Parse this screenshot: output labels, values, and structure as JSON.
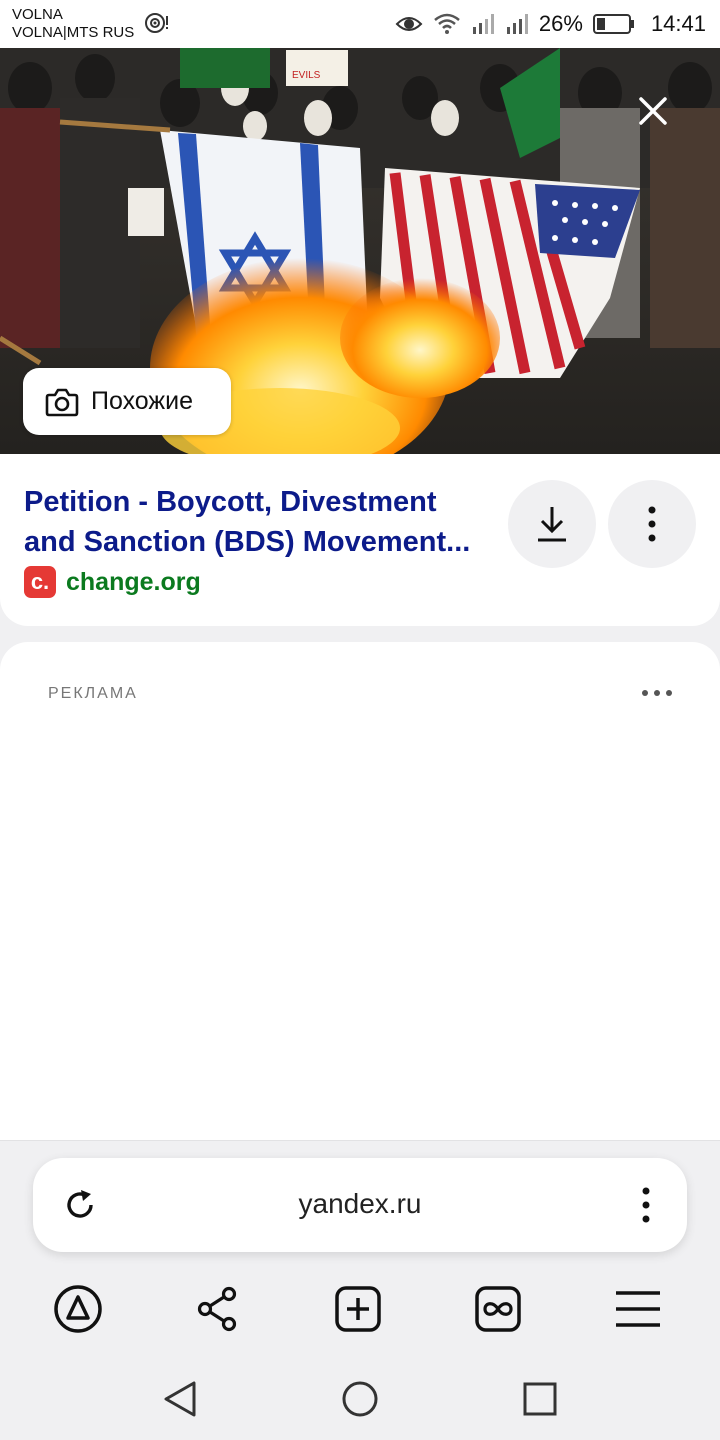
{
  "status_bar": {
    "carrier_1": "VOLNA",
    "carrier_2": "VOLNA|MTS RUS",
    "battery_percent": "26%",
    "battery_level": 0.26,
    "time": "14:41"
  },
  "image_viewer": {
    "similar_button_label": "Похожие",
    "banner_text": "EVILS"
  },
  "result": {
    "title_line_1": "Petition - Boycott, Divestment",
    "title_line_2": "and Sanction (BDS) Movement...",
    "favicon_letter": "c.",
    "source_domain": "change.org"
  },
  "ad": {
    "label": "РЕКЛАМА"
  },
  "browser": {
    "url": "yandex.ru"
  },
  "icons": {
    "carrier_extra": "eye-icon",
    "toolbar": [
      "alice-icon",
      "share-icon",
      "new-tab-icon",
      "tabs-icon",
      "menu-icon"
    ],
    "navigation": [
      "back-icon",
      "home-icon",
      "recents-icon"
    ]
  },
  "colors": {
    "title": "#0c1b8a",
    "domain": "#0b7a1f",
    "favicon": "#e53935"
  }
}
